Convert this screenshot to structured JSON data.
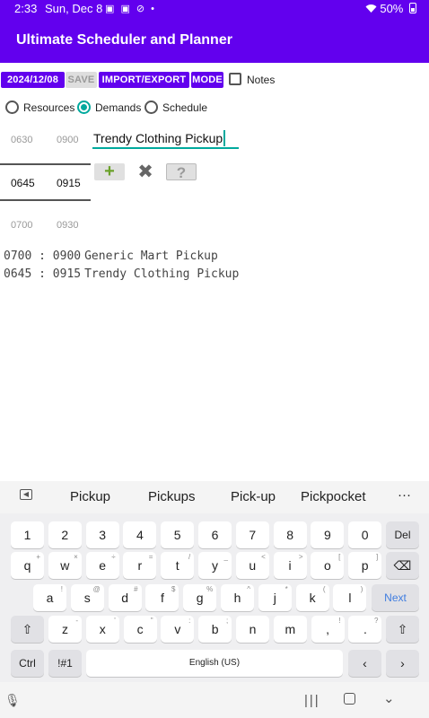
{
  "status_bar": {
    "time": "2:33",
    "date": "Sun, Dec 8",
    "icons": "▣ ▣ ⊘ •",
    "wifi": "wifi-icon",
    "battery": "50%"
  },
  "app_bar": {
    "title": "Ultimate Scheduler and Planner"
  },
  "toolbar": {
    "date_label": "2024/12/08",
    "save_label": "SAVE",
    "import_export_label": "IMPORT/EXPORT",
    "mode_label": "MODE",
    "notes_label": "Notes",
    "notes_checked": false
  },
  "radios": {
    "options": [
      "Resources",
      "Demands",
      "Schedule"
    ],
    "selected": "Demands"
  },
  "time_picker": {
    "start_column": [
      "0630",
      "0645",
      "0700"
    ],
    "end_column": [
      "0900",
      "0915",
      "0930"
    ],
    "selected_index": 1
  },
  "name_input": {
    "value": "Trendy Clothing Pickup"
  },
  "actions": {
    "add_icon": "plus-icon",
    "delete_icon": "close-icon",
    "help_label": "?"
  },
  "demands": [
    {
      "start": "0700",
      "sep": ":",
      "end": "0900",
      "name": "Generic Mart Pickup"
    },
    {
      "start": "0645",
      "sep": ":",
      "end": "0915",
      "name": "Trendy Clothing Pickup"
    }
  ],
  "keyboard": {
    "suggestions": [
      "Pickup",
      "Pickups",
      "Pick-up",
      "Pickpocket"
    ],
    "more": "···",
    "row1": [
      "1",
      "2",
      "3",
      "4",
      "5",
      "6",
      "7",
      "8",
      "9",
      "0"
    ],
    "del": "Del",
    "row2": [
      "q",
      "w",
      "e",
      "r",
      "t",
      "y",
      "u",
      "i",
      "o",
      "p"
    ],
    "row2_sup": [
      "+",
      "×",
      "÷",
      "=",
      "/",
      "_",
      "<",
      ">",
      "[",
      "]"
    ],
    "row3": [
      "a",
      "s",
      "d",
      "f",
      "g",
      "h",
      "j",
      "k",
      "l"
    ],
    "row3_sup": [
      "!",
      "@",
      "#",
      "$",
      "%",
      "^",
      "*",
      "(",
      ")"
    ],
    "next": "Next",
    "row4": [
      "z",
      "x",
      "c",
      "v",
      "b",
      "n",
      "m",
      ",",
      "."
    ],
    "row4_sup": [
      "-",
      "'",
      "\"",
      ":",
      ";",
      "",
      "",
      "!",
      "?"
    ],
    "ctrl": "Ctrl",
    "sym": "!#1",
    "space": "English (US)"
  },
  "colors": {
    "primary": "#6200ee",
    "accent": "#00a99d",
    "add_green": "#6ba12a"
  }
}
